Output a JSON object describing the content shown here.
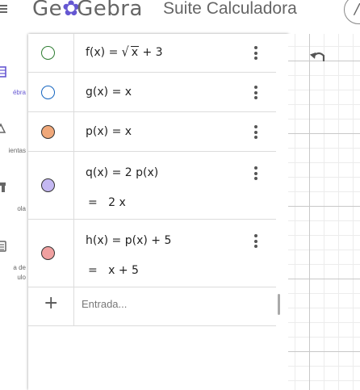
{
  "header": {
    "logo_text_before": "Ge",
    "logo_text_after": "Gebra",
    "title": "Suite Calculadora",
    "search_glyph": "/"
  },
  "sidebar": {
    "items": [
      {
        "label": "ébra",
        "icon": "algebra-icon",
        "active": true
      },
      {
        "label": "ientas",
        "icon": "tools-icon",
        "active": false
      },
      {
        "label": "ola",
        "icon": "table-icon",
        "active": false
      },
      {
        "label": "a de",
        "label2": "ulo",
        "icon": "calculator-icon",
        "active": false
      }
    ]
  },
  "algebra": {
    "rows": [
      {
        "name": "f",
        "lhs": "f(x)",
        "eq": "=",
        "rhs_pre": "",
        "rhs_sqrt": "x",
        "rhs_post": "+ 3",
        "color": "#ffffff",
        "border": "#2e7d32",
        "output": ""
      },
      {
        "name": "g",
        "lhs": "g(x)",
        "eq": "=",
        "rhs_pre": "x",
        "color": "#ffffff",
        "border": "#1565c0",
        "output": ""
      },
      {
        "name": "p",
        "lhs": "p(x)",
        "eq": "=",
        "rhs_pre": "x",
        "color": "#f0a87a",
        "border": "#333333",
        "output": ""
      },
      {
        "name": "q",
        "lhs": "q(x)",
        "eq": "=",
        "rhs_pre": "2 p(x)",
        "color": "#c4b8f2",
        "border": "#333333",
        "output": "2 x"
      },
      {
        "name": "h",
        "lhs": "h(x)",
        "eq": "=",
        "rhs_pre": "p(x) + 5",
        "color": "#f0a0a0",
        "border": "#333333",
        "output": "x + 5"
      }
    ],
    "output_eq": "=",
    "input_placeholder": "Entrada..."
  },
  "colors": {
    "accent": "#6557d2",
    "divider": "#dcdcdc"
  }
}
